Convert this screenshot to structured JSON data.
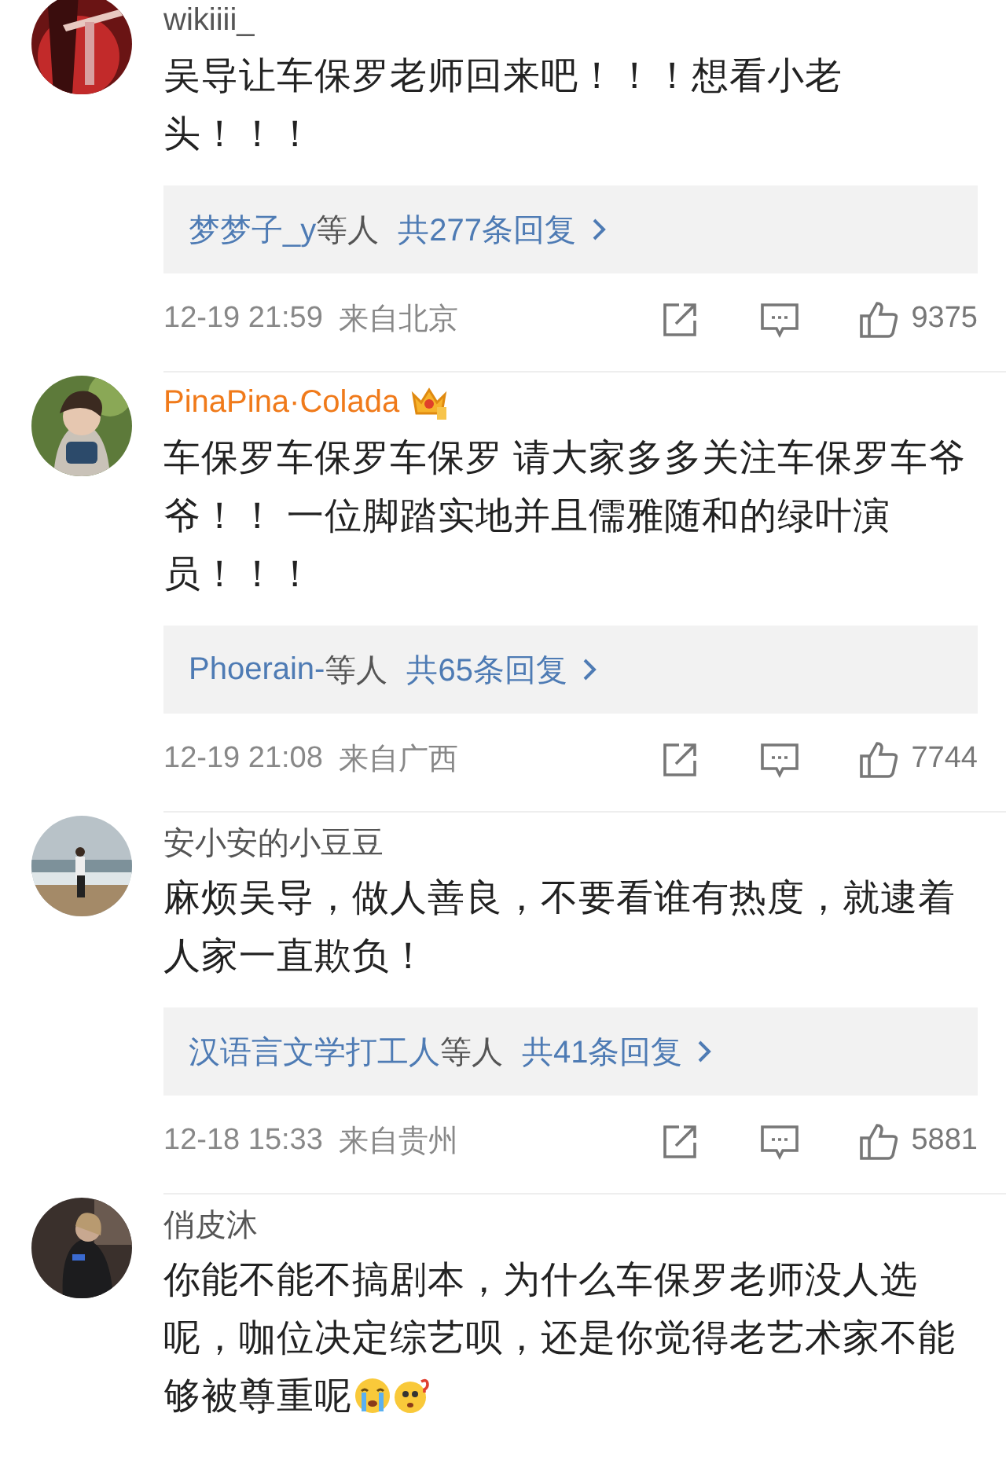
{
  "comments": [
    {
      "username": "wikiiii_",
      "vip": false,
      "text": "吴导让车保罗老师回来吧！！！想看小老头！！！",
      "reply_preview": {
        "user": "梦梦子_y",
        "suffix": "等人",
        "total": "共277条回复"
      },
      "time": "12-19 21:59",
      "location": "来自北京",
      "likes": "9375"
    },
    {
      "username": "PinaPina·Colada",
      "vip": true,
      "badge": {
        "kind": "crown"
      },
      "text": "车保罗车保罗车保罗 请大家多多关注车保罗车爷爷！！ 一位脚踏实地并且儒雅随和的绿叶演员！！！",
      "reply_preview": {
        "user": "Phoerain-",
        "suffix": "等人",
        "total": "共65条回复"
      },
      "time": "12-19 21:08",
      "location": "来自广西",
      "likes": "7744"
    },
    {
      "username": "安小安的小豆豆",
      "vip": false,
      "text": "麻烦吴导，做人善良，不要看谁有热度，就逮着人家一直欺负！",
      "reply_preview": {
        "user": "汉语言文学打工人",
        "suffix": "等人",
        "total": "共41条回复"
      },
      "time": "12-18 15:33",
      "location": "来自贵州",
      "likes": "5881"
    },
    {
      "username": "俏皮沐",
      "vip": false,
      "text": "你能不能不搞剧本，为什么车保罗老师没人选呢，咖位决定综艺呗，还是你觉得老艺术家不能够被尊重呢",
      "emojis": [
        {
          "kind": "crying"
        },
        {
          "kind": "confused"
        }
      ]
    }
  ]
}
